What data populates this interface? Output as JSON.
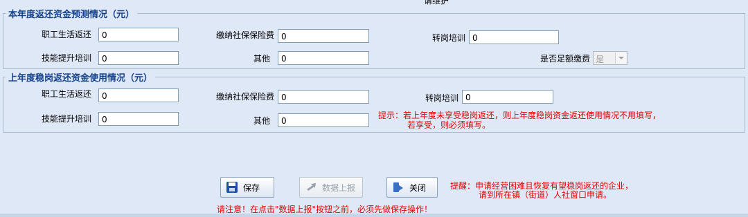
{
  "top_cut_text": "请维护",
  "section_current": {
    "legend": "本年度返还资金预测情况（元）",
    "fields": [
      {
        "label": "职工生活返还",
        "value": "0"
      },
      {
        "label": "缴纳社保保险费",
        "value": "0"
      },
      {
        "label": "转岗培训",
        "value": "0"
      },
      {
        "label": "技能提升培训",
        "value": "0"
      },
      {
        "label": "其他",
        "value": "0"
      }
    ],
    "full_payment_label": "是否足额缴费",
    "full_payment_value": "是"
  },
  "section_last": {
    "legend": "上年度稳岗返还资金使用情况（元）",
    "fields": [
      {
        "label": "职工生活返还",
        "value": "0"
      },
      {
        "label": "缴纳社保保险费",
        "value": "0"
      },
      {
        "label": "转岗培训",
        "value": "0"
      },
      {
        "label": "技能提升培训",
        "value": "0"
      },
      {
        "label": "其他",
        "value": "0"
      }
    ],
    "hint_line1": "提示：若上年度未享受稳岗返还，则上年度稳岗资金返还使用情况不用填写，",
    "hint_line2": "若享受，则必须填写。"
  },
  "buttons": {
    "save": "保存",
    "upload": "数据上报",
    "close": "关闭"
  },
  "reminder_line1": "提醒：申请经营困难且恢复有望稳岗返还的企业，",
  "reminder_line2": "请到所在镇（街道）人社窗口申请。",
  "notice": "请注意！在点击\"数据上报\"按钮之前，必须先做保存操作！",
  "colors": {
    "legend": "#15428b",
    "hint": "#e60000",
    "background": "#dfe8f6"
  }
}
